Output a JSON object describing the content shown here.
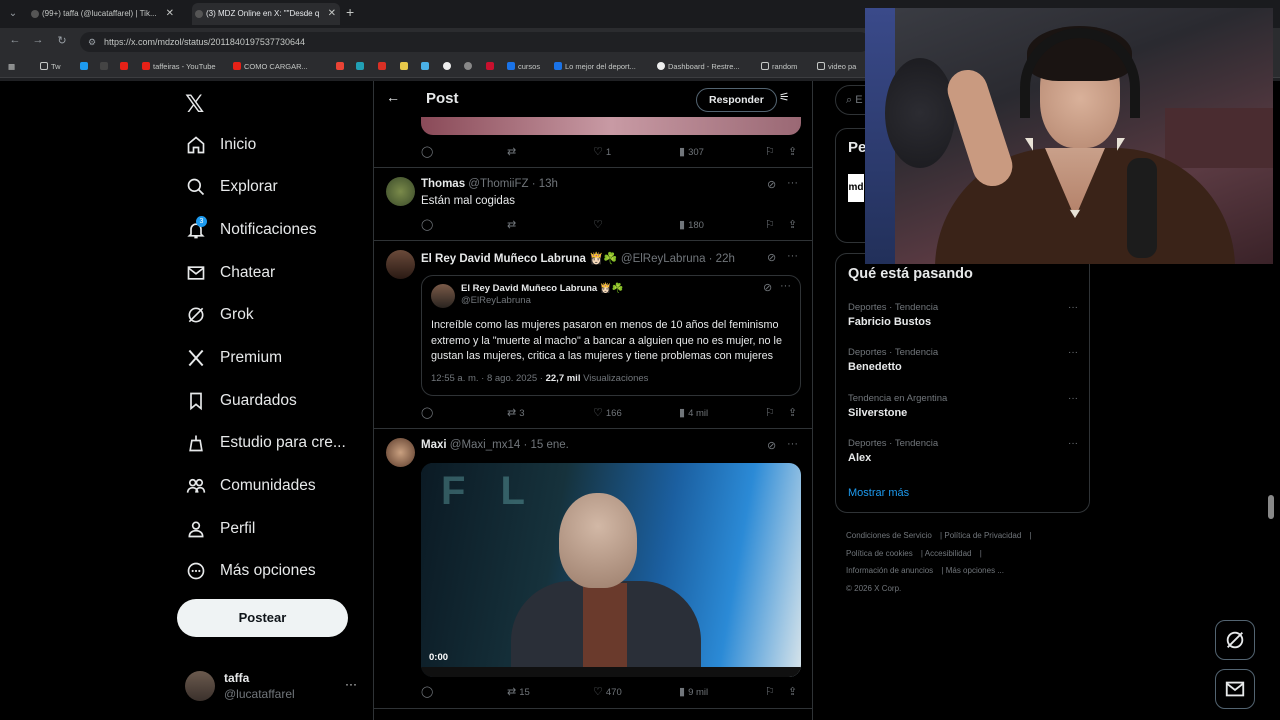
{
  "browser": {
    "tabs": [
      {
        "title": "(99+) taffa (@lucataffarel) | Tik..."
      },
      {
        "title": "(3) MDZ Online en X: \"\"Desde q"
      }
    ],
    "url": "https://x.com/mdzol/status/2011840197537730644",
    "bookmarks": [
      "Tw",
      "taffeiras - YouTube",
      "COMO CARGAR...",
      "cursos",
      "Lo mejor del deport...",
      "Dashboard - Restre...",
      "random",
      "video pa"
    ]
  },
  "nav": {
    "items": [
      {
        "label": "Inicio",
        "icon": "home-icon"
      },
      {
        "label": "Explorar",
        "icon": "search-icon"
      },
      {
        "label": "Notificaciones",
        "icon": "bell-icon",
        "badge": "3"
      },
      {
        "label": "Chatear",
        "icon": "mail-icon"
      },
      {
        "label": "Grok",
        "icon": "grok-icon"
      },
      {
        "label": "Premium",
        "icon": "x-icon"
      },
      {
        "label": "Guardados",
        "icon": "bookmark-icon"
      },
      {
        "label": "Estudio para cre...",
        "icon": "studio-icon"
      },
      {
        "label": "Comunidades",
        "icon": "communities-icon"
      },
      {
        "label": "Perfil",
        "icon": "person-icon"
      },
      {
        "label": "Más opciones",
        "icon": "more-icon"
      }
    ],
    "post_button": "Postear",
    "account": {
      "name": "taffa",
      "handle": "@lucataffarel"
    }
  },
  "header": {
    "title": "Post",
    "reply_button": "Responder"
  },
  "posts": [
    {
      "actions": {
        "reply": "",
        "repost": "",
        "like": "1",
        "views": "307"
      }
    },
    {
      "name": "Thomas",
      "handle": "@ThomiiFZ · 13h",
      "text": "Están mal cogidas",
      "actions": {
        "reply": "",
        "repost": "",
        "like": "",
        "views": "180"
      }
    },
    {
      "name": "El Rey David Muñeco Labruna 👸🏻☘️",
      "handle": "@ElReyLabruna · 22h",
      "quote": {
        "name": "El Rey David Muñeco Labruna 👸🏻☘️",
        "handle": "@ElReyLabruna",
        "text": "Increíble como las mujeres pasaron en menos de 10 años del feminismo extremo y la \"muerte al macho\" a bancar a alguien que no es mujer, no le gustan las mujeres, critica a las mujeres y tiene problemas con mujeres",
        "time": "12:55 a. m. · 8 ago. 2025 ·",
        "views": "22,7 mil",
        "views_label": "Visualizaciones"
      },
      "actions": {
        "reply": "",
        "repost": "3",
        "like": "166",
        "views": "4 mil"
      }
    },
    {
      "name": "Maxi",
      "handle": "@Maxi_mx14 · 15 ene.",
      "video_time": "0:00",
      "actions": {
        "reply": "",
        "repost": "15",
        "like": "470",
        "views": "9 mil"
      }
    }
  ],
  "right": {
    "search_placeholder": "E",
    "card_title": "Pe",
    "card_logo": "md",
    "trends_title": "Qué está pasando",
    "trends": [
      {
        "category": "Deportes · Tendencia",
        "name": "Fabricio Bustos"
      },
      {
        "category": "Deportes · Tendencia",
        "name": "Benedetto"
      },
      {
        "category": "Tendencia en Argentina",
        "name": "Silverstone"
      },
      {
        "category": "Deportes · Tendencia",
        "name": "Alex"
      }
    ],
    "show_more": "Mostrar más",
    "footer": [
      "Condiciones de Servicio",
      "Política de Privacidad",
      "Política de cookies",
      "Accesibilidad",
      "Información de anuncios",
      "Más opciones ...",
      "© 2026 X Corp."
    ]
  },
  "colors": {
    "accent": "#1d9bf0",
    "background": "#000000",
    "border": "#2f3336",
    "muted": "#71767b"
  }
}
